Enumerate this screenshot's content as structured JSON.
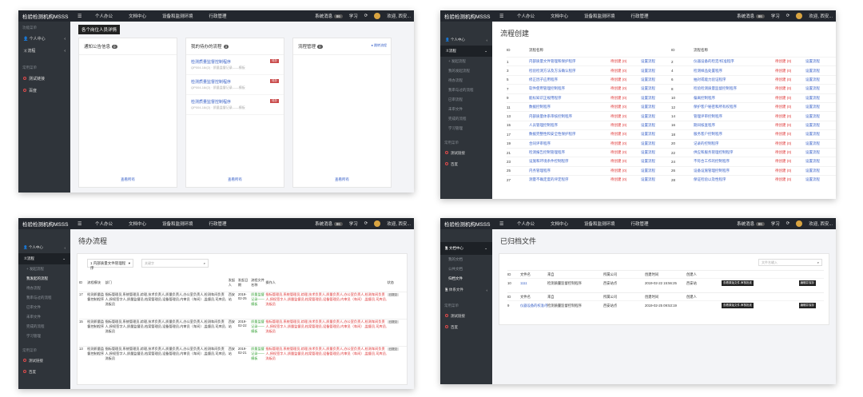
{
  "app": {
    "brand": "检验检测机构MSSS",
    "nav": [
      "个人办公",
      "文档中心",
      "设备和监测环境",
      "行政管理"
    ],
    "msg_label": "系统消息",
    "msg_count": "86",
    "study": "学习",
    "welcome": "欢迎, 西安..."
  },
  "p1": {
    "sidebar": {
      "section1": "功能菜单",
      "items": [
        "个人中心",
        "流程"
      ],
      "section2": "常用菜单",
      "links": [
        "测试链接",
        "百度"
      ]
    },
    "banner": "各个岗位人员详情",
    "cards": [
      {
        "title": "通知公告信息",
        "count": "0",
        "footer": "查看所有"
      },
      {
        "title": "我的待办的流程",
        "count": "3",
        "footer": "查看所有",
        "items": [
          {
            "t": "检测质量监督控制程序",
            "s": "QP004-18/(2) · 质量监督记录——模板",
            "tag": "待办"
          },
          {
            "t": "检测质量监督控制程序",
            "s": "QP004-18/(2) · 质量监督记录——模板",
            "tag": "待办"
          },
          {
            "t": "检测质量监督控制程序",
            "s": "QP004-18/(2) · 质量监督记录——模板",
            "tag": "待办"
          }
        ]
      },
      {
        "title": "流程管理",
        "count": "0",
        "footer": "查看所有",
        "link": "● 跳转流程"
      }
    ]
  },
  "p2": {
    "sidebar": {
      "items": [
        "个人中心",
        "流程"
      ],
      "subs": [
        "+ 发起流程",
        "我的发起流程",
        "待办流程",
        "我审与过的流程",
        "已审流程",
        "未审文件",
        "完成的流程",
        "学习管理"
      ],
      "section2": "常用菜单",
      "links": [
        "测试链接",
        "百度"
      ]
    },
    "title": "流程创建",
    "headers": [
      "ID",
      "流程名称"
    ],
    "status": "待创建 (0)",
    "action": "设置流程",
    "left": [
      [
        "1",
        "内部质量文件管理和保护程序"
      ],
      [
        "3",
        "检验检测方法及方法确认程序"
      ],
      [
        "5",
        "修正因子应用程序"
      ],
      [
        "7",
        "软件使用管理控制程序"
      ],
      [
        "9",
        "能标知识正规用程序"
      ],
      [
        "11",
        "数据控制程序"
      ],
      [
        "13",
        "内部质量体系审核控制程序"
      ],
      [
        "15",
        "人员管理控制程序"
      ],
      [
        "17",
        "数据完整性和安全性保护程序"
      ],
      [
        "19",
        "合同评审程序"
      ],
      [
        "21",
        "检测报告控制管理程序"
      ],
      [
        "23",
        "设施和环境条件控制程序"
      ],
      [
        "25",
        "内务管理程序"
      ],
      [
        "27",
        "测量不确定度的评定程序"
      ]
    ],
    "right": [
      [
        "2",
        "仪器设备的检定/校准程序"
      ],
      [
        "4",
        "检测样品处置程序"
      ],
      [
        "6",
        "抽对或能力验证程序"
      ],
      [
        "8",
        "检验检测质量监督控制程序"
      ],
      [
        "10",
        "偏离控制程序"
      ],
      [
        "12",
        "保护客户秘密和所有权程序"
      ],
      [
        "14",
        "管理评审控制程序"
      ],
      [
        "16",
        "期间核查程序"
      ],
      [
        "18",
        "服务客户控制程序"
      ],
      [
        "20",
        "记录的控制程序"
      ],
      [
        "22",
        "供应和服务管理控制程序"
      ],
      [
        "24",
        "不符合工作的控制程序"
      ],
      [
        "26",
        "设备设施管理控制程序"
      ],
      [
        "28",
        "保证检验以及性程序"
      ]
    ]
  },
  "p3": {
    "sidebar": {
      "items": [
        "个人中心",
        "流程"
      ],
      "subs": [
        "+ 发起流程",
        "我发起的流程",
        "待办流程",
        "我审与过的流程",
        "已审文件",
        "未审文件",
        "完成的流程",
        "学习管理"
      ],
      "section2": "常用菜单",
      "links": [
        "测试链接",
        "百度"
      ]
    },
    "title": "待办流程",
    "select": "1 内部质量文件管理程序",
    "search_placeholder": "关键字",
    "headers": [
      "ID",
      "流程模块",
      "部门",
      "发起人",
      "发起日期",
      "流程文件名称",
      "操作人",
      "状态"
    ],
    "rows": [
      {
        "id": "17",
        "module": "检测质量监督控制程序",
        "dept": "指标管理员,系统管理员,综理,技术负责人,质量负责人,办公室负责人,检测车间负责人,授权签字人,质量监督员,档案管理员,设备管理员,内审员（车间）,监督员,司库员,洗板员",
        "who": "西安站",
        "date": "2019-02-25",
        "file": "质量监督记录——模板",
        "ops": "指标管理员,系统管理员,综理,技术负责人,质量负责人,办公室负责人,检测车间负责人,授权签字人,质量监督员,档案管理员,设备管理员,内审员（车间）,监督员,司库员,洗板员",
        "state": "已提交"
      },
      {
        "id": "15",
        "module": "检测质量监督控制程序",
        "dept": "指标管理员,系统管理员,综理,技术负责人,质量负责人,办公室负责人,检测车间负责人,授权签字人,质量监督员,档案管理员,设备管理员,内审员（车间）,监督员,司库员,洗板员",
        "who": "西安站",
        "date": "2019-02-22",
        "file": "质量监督记录——模板",
        "ops": "指标管理员,系统管理员,综理,技术负责人,质量负责人,办公室负责人,检测车间负责人,授权签字人,质量监督员,档案管理员,设备管理员,内审员（车间）,监督员,司库员,洗板员",
        "state": "已提交"
      },
      {
        "id": "13",
        "module": "检测质量监督控制程序",
        "dept": "指标管理员,系统管理员,综理,技术负责人,质量负责人,办公室负责人,检测车间负责人,授权签字人,质量监督员,档案管理员,设备管理员,内审员（车间）,监督员,司库员,洗板员",
        "who": "西安站",
        "date": "2019-02-21",
        "file": "质量监督记录——模板",
        "ops": "指标管理员,系统管理员,综理,技术负责人,质量负责人,办公室负责人,检测车间负责人,授权签字人,质量监督员,档案管理员,设备管理员,内审员（车间）,监督员,司库员,洗板员",
        "state": "已提交"
      }
    ]
  },
  "p4": {
    "sidebar": {
      "items": [
        "文档中心",
        "体系文件"
      ],
      "subs": [
        "我的文档",
        "公共文档",
        "归档文件"
      ],
      "section2": "常用菜单",
      "links": [
        "测试链接",
        "百度"
      ]
    },
    "title": "已归档文件",
    "search_placeholder": "文件名输入",
    "headers": [
      "ID",
      "文件名",
      "来自",
      "所属公司",
      "创建时间",
      "创建人"
    ],
    "rows": [
      {
        "id": "10",
        "name": "1111",
        "from": "检测质量监督控制程序",
        "co": "西安站点",
        "time": "2019-02-22 15:56:25",
        "who": "西安站",
        "b1": "查看原始文件,审核批准",
        "b2": "编辑并保存"
      },
      {
        "id": "9",
        "name": "仪器设备的校准/检定程序",
        "from": "检测质量监督控制程序",
        "co": "西安站点",
        "time": "2019-02-25 09:53:19",
        "who": "",
        "b1": "查看原始文件,审核批准",
        "b2": "编辑并保存"
      }
    ]
  }
}
